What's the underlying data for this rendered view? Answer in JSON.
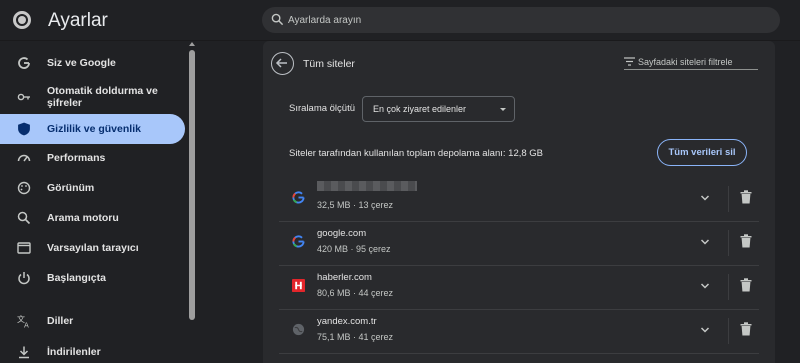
{
  "header": {
    "title": "Ayarlar",
    "search_placeholder": "Ayarlarda arayın"
  },
  "sidebar": {
    "items": [
      {
        "label": "Siz ve Google",
        "icon": "google-g-icon",
        "active": false
      },
      {
        "label": "Otomatik doldurma ve şifreler",
        "icon": "key-icon",
        "active": false
      },
      {
        "label": "Gizlilik ve güvenlik",
        "icon": "shield-icon",
        "active": true
      },
      {
        "label": "Performans",
        "icon": "speedometer-icon",
        "active": false
      },
      {
        "label": "Görünüm",
        "icon": "palette-icon",
        "active": false
      },
      {
        "label": "Arama motoru",
        "icon": "search-icon",
        "active": false
      },
      {
        "label": "Varsayılan tarayıcı",
        "icon": "browser-window-icon",
        "active": false
      },
      {
        "label": "Başlangıçta",
        "icon": "power-icon",
        "active": false
      },
      {
        "label": "Diller",
        "icon": "translate-icon",
        "active": false
      },
      {
        "label": "İndirilenler",
        "icon": "download-icon",
        "active": false
      }
    ]
  },
  "main": {
    "title": "Tüm siteler",
    "filter_placeholder": "Sayfadaki siteleri filtrele",
    "sort_label": "Sıralama ölçütü",
    "sort_value": "En çok ziyaret edilenler",
    "storage_text": "Siteler tarafından kullanılan toplam depolama alanı: 12,8 GB",
    "clear_all_label": "Tüm verileri sil",
    "accent_color": "#a8c7fa",
    "sites": [
      {
        "name": "",
        "meta": "32,5 MB · 13 çerez",
        "icon": "google-g-icon",
        "redacted": true
      },
      {
        "name": "google.com",
        "meta": "420 MB · 95 çerez",
        "icon": "google-g-icon",
        "redacted": false
      },
      {
        "name": "haberler.com",
        "meta": "80,6 MB · 44 çerez",
        "icon": "haberler-h-icon",
        "redacted": false
      },
      {
        "name": "yandex.com.tr",
        "meta": "75,1 MB · 41 çerez",
        "icon": "globe-icon",
        "redacted": false
      }
    ]
  }
}
